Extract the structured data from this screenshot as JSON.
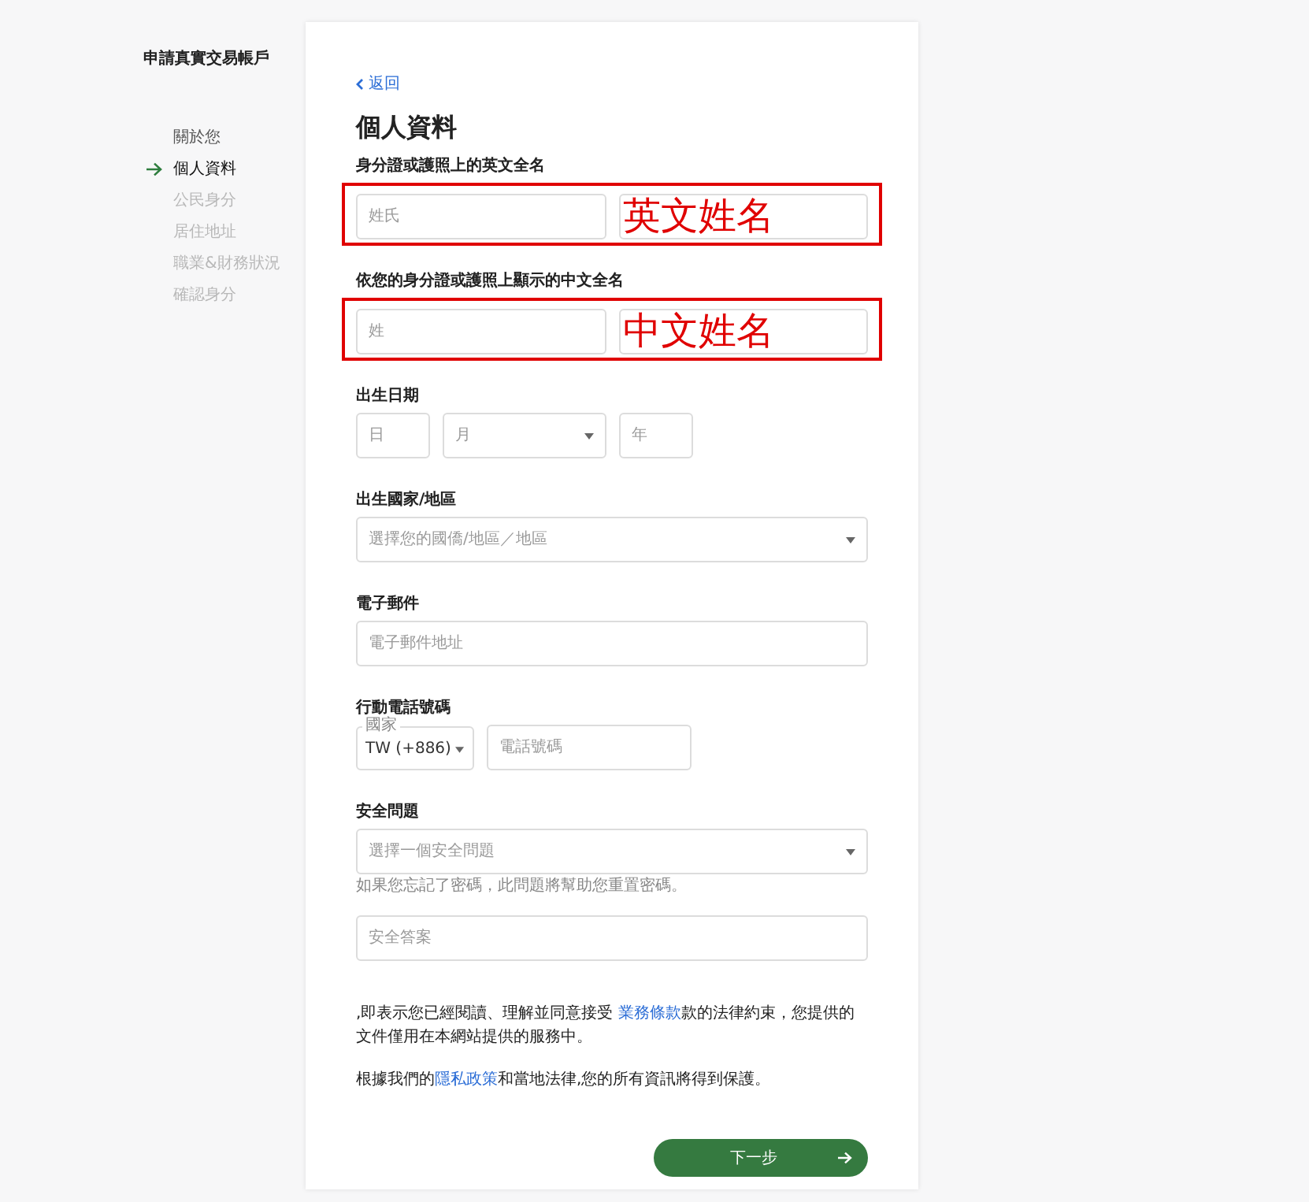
{
  "sidebar": {
    "title": "申請真實交易帳戶",
    "steps": [
      {
        "label": "關於您",
        "selected": false,
        "disabled": false
      },
      {
        "label": "個人資料",
        "selected": true,
        "disabled": false
      },
      {
        "label": "公民身分",
        "selected": false,
        "disabled": true
      },
      {
        "label": "居住地址",
        "selected": false,
        "disabled": true
      },
      {
        "label": "職業&財務狀況",
        "selected": false,
        "disabled": true
      },
      {
        "label": "確認身分",
        "selected": false,
        "disabled": true
      }
    ]
  },
  "form": {
    "back_link": "返回",
    "title": "個人資料",
    "sections": [
      {
        "kind": "pair",
        "label": "身分證或護照上的英文全名",
        "annotation": "英文姓名",
        "fields": [
          {
            "kind": "input",
            "placeholder": "姓氏"
          },
          {
            "kind": "input"
          }
        ]
      },
      {
        "kind": "pair",
        "label": "依您的身分證或護照上顯示的中文全名",
        "annotation": "中文姓名",
        "fields": [
          {
            "kind": "input",
            "placeholder": "姓"
          },
          {
            "kind": "input"
          }
        ]
      },
      {
        "kind": "date",
        "label": "出生日期",
        "fields": [
          {
            "kind": "input",
            "placeholder": "日"
          },
          {
            "kind": "select",
            "placeholder": "月"
          },
          {
            "kind": "input",
            "placeholder": "年"
          }
        ]
      },
      {
        "kind": "full",
        "label": "出生國家/地區",
        "fields": [
          {
            "kind": "select",
            "placeholder": "選擇您的國僑/地區／地區"
          }
        ]
      },
      {
        "kind": "full",
        "label": "電子郵件",
        "fields": [
          {
            "kind": "input",
            "placeholder": "電子郵件地址"
          }
        ]
      },
      {
        "kind": "phone",
        "label": "行動電話號碼",
        "fields": [
          {
            "kind": "code",
            "floating_label": "國家",
            "value": "TW (+886)"
          },
          {
            "kind": "input",
            "placeholder": "電話號碼"
          }
        ]
      },
      {
        "kind": "full",
        "label": "安全問題",
        "hint": "如果您忘記了密碼，此問題將幫助您重置密碼。",
        "fields": [
          {
            "kind": "select",
            "placeholder": "選擇一個安全問題"
          }
        ]
      },
      {
        "kind": "full",
        "fields": [
          {
            "kind": "input",
            "placeholder": "安全答案"
          }
        ]
      }
    ],
    "paragraphs": [
      {
        "parts": [
          {
            "kind": "text",
            "text": ",即表示您已經閱讀、理解並同意接受 "
          },
          {
            "kind": "link",
            "text": "業務條款"
          },
          {
            "kind": "text",
            "text": "款的法律約束，您提供的文件僅用在本網站提供的服務中。"
          }
        ]
      },
      {
        "parts": [
          {
            "kind": "text",
            "text": "根據我們的"
          },
          {
            "kind": "link",
            "text": "隱私政策"
          },
          {
            "kind": "text",
            "text": "和當地法律,您的所有資訊將得到保護。"
          }
        ]
      }
    ],
    "next_button": "下一步"
  }
}
